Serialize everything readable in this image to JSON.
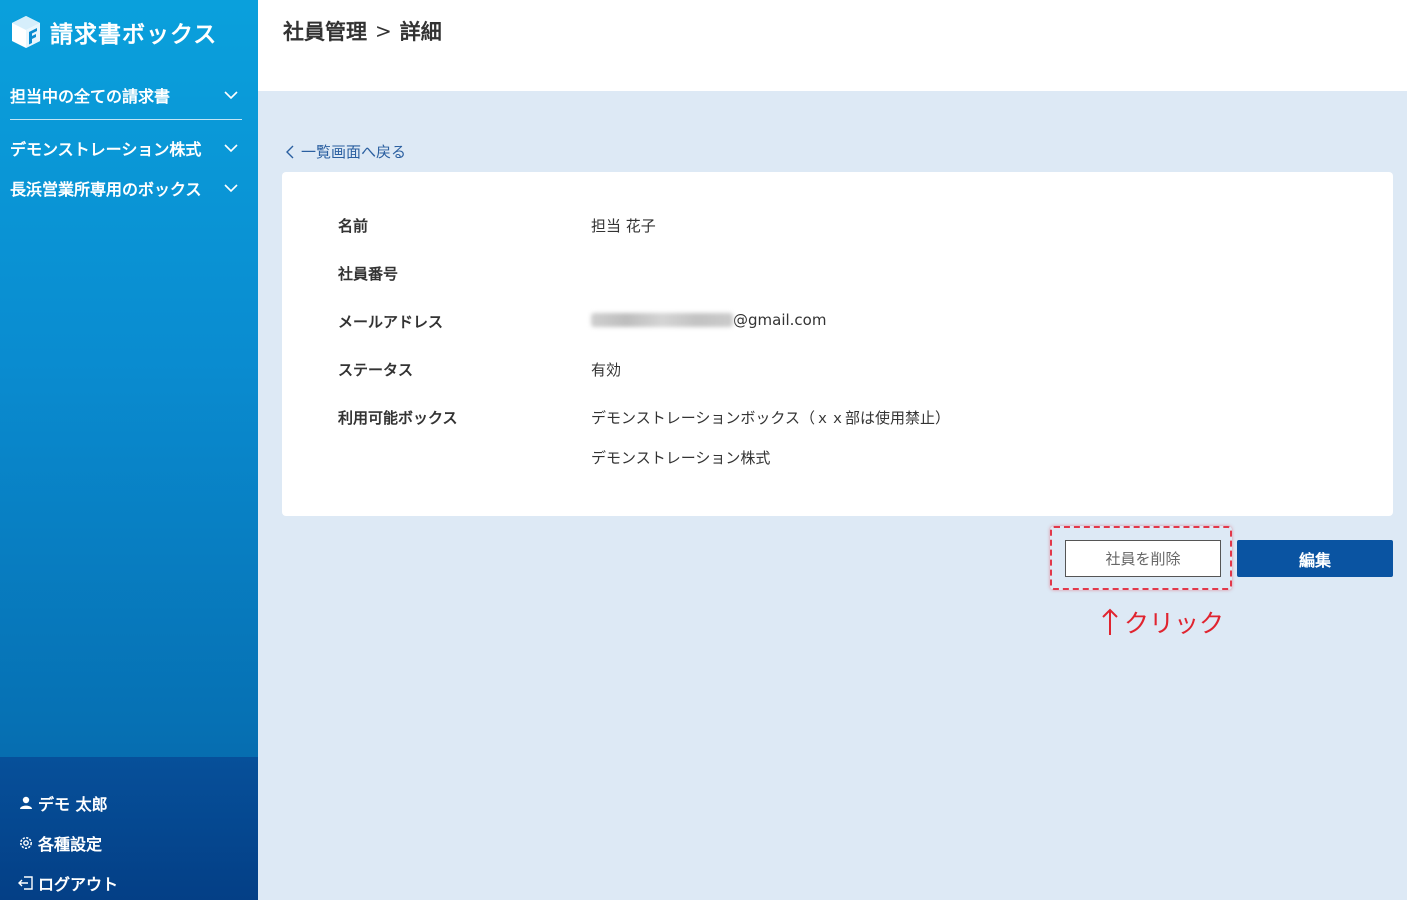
{
  "app": {
    "name": "請求書ボックス"
  },
  "sidebar": {
    "items": [
      {
        "label": "担当中の全ての請求書"
      },
      {
        "label": "デモンストレーション株式"
      },
      {
        "label": "長浜営業所専用のボックス"
      }
    ],
    "bottom": {
      "user": "デモ 太郎",
      "settings": "各種設定",
      "logout": "ログアウト"
    }
  },
  "header": {
    "breadcrumb": {
      "parent": "社員管理",
      "separator": ">",
      "current": "詳細"
    }
  },
  "main": {
    "back_link": "一覧画面へ戻る",
    "details": {
      "name_label": "名前",
      "name_value": "担当 花子",
      "number_label": "社員番号",
      "number_value": "",
      "email_label": "メールアドレス",
      "email_domain": "@gmail.com",
      "status_label": "ステータス",
      "status_value": "有効",
      "boxes_label": "利用可能ボックス",
      "boxes": [
        "デモンストレーションボックス（ｘｘ部は使用禁止）",
        "デモンストレーション株式"
      ]
    },
    "buttons": {
      "delete": "社員を削除",
      "edit": "編集"
    }
  },
  "annotation": {
    "text": "クリック",
    "color": "#e0242f"
  },
  "colors": {
    "accent": "#0a54a2",
    "sidebar_top": "#0aa0dc",
    "background": "#dde9f5"
  }
}
